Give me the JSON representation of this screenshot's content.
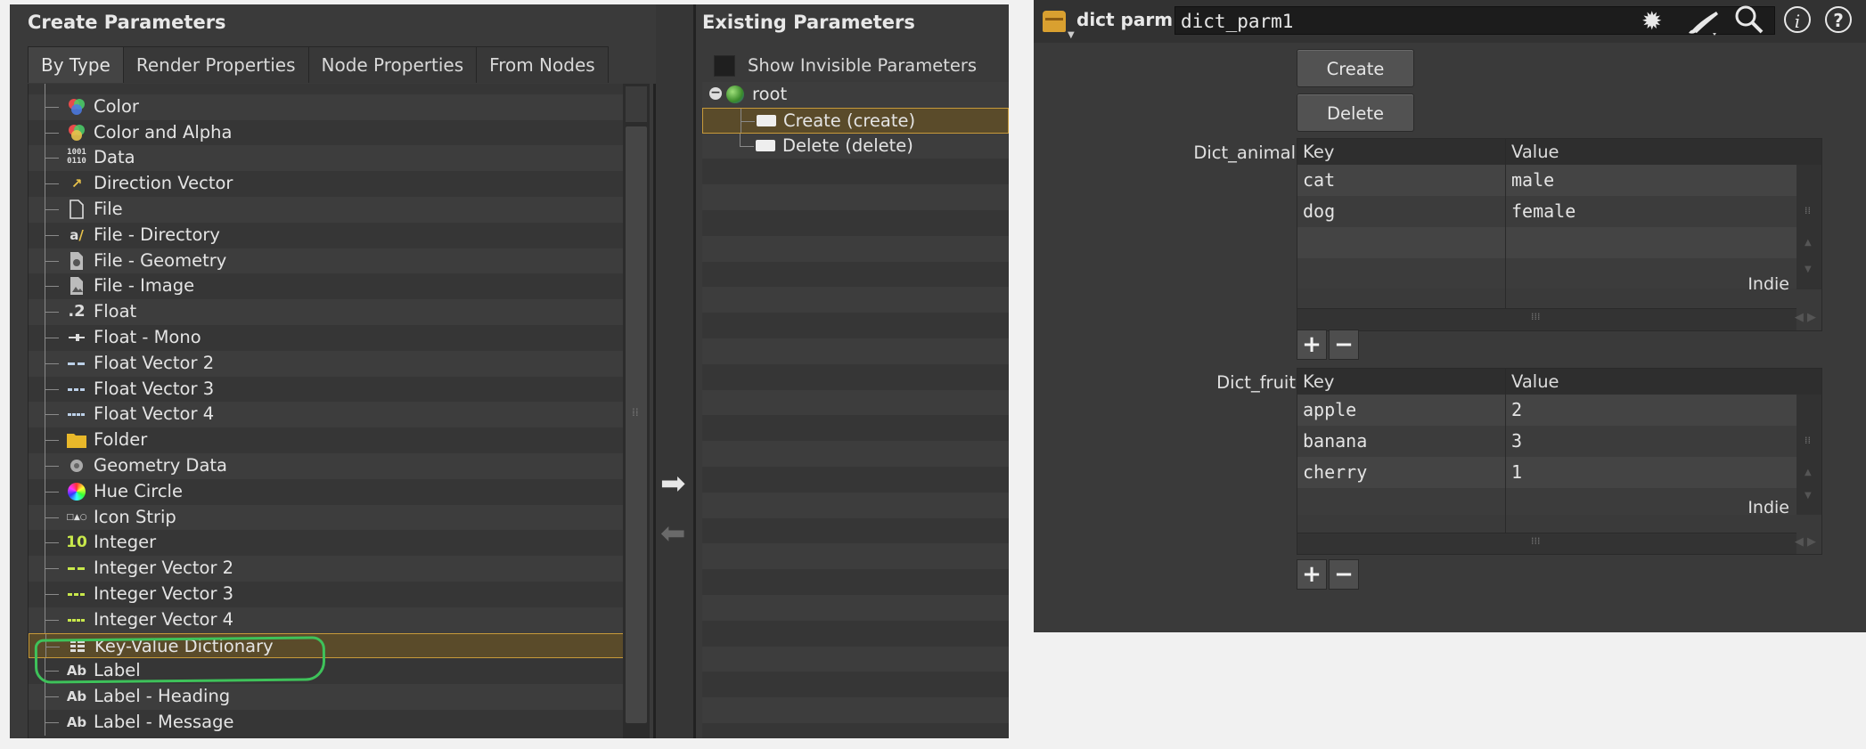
{
  "left_panel": {
    "create_title": "Create Parameters",
    "existing_title": "Existing Parameters",
    "tabs": [
      {
        "label": "By Type",
        "active": true
      },
      {
        "label": "Render Properties",
        "active": false
      },
      {
        "label": "Node Properties",
        "active": false
      },
      {
        "label": "From Nodes",
        "active": false
      }
    ],
    "types": [
      {
        "label": "Color",
        "icon": "color-icon"
      },
      {
        "label": "Color and Alpha",
        "icon": "color-alpha-icon"
      },
      {
        "label": "Data",
        "icon": "data-icon"
      },
      {
        "label": "Direction Vector",
        "icon": "direction-vector-icon"
      },
      {
        "label": "File",
        "icon": "file-icon"
      },
      {
        "label": "File - Directory",
        "icon": "directory-icon"
      },
      {
        "label": "File - Geometry",
        "icon": "geometry-file-icon"
      },
      {
        "label": "File - Image",
        "icon": "image-file-icon"
      },
      {
        "label": "Float",
        "icon": "float-icon"
      },
      {
        "label": "Float - Mono",
        "icon": "float-mono-icon"
      },
      {
        "label": "Float Vector 2",
        "icon": "float-vector2-icon"
      },
      {
        "label": "Float Vector 3",
        "icon": "float-vector3-icon"
      },
      {
        "label": "Float Vector 4",
        "icon": "float-vector4-icon"
      },
      {
        "label": "Folder",
        "icon": "folder-icon"
      },
      {
        "label": "Geometry Data",
        "icon": "geometry-data-icon"
      },
      {
        "label": "Hue Circle",
        "icon": "hue-circle-icon"
      },
      {
        "label": "Icon Strip",
        "icon": "icon-strip-icon"
      },
      {
        "label": "Integer",
        "icon": "integer-icon"
      },
      {
        "label": "Integer Vector 2",
        "icon": "integer-vector2-icon"
      },
      {
        "label": "Integer Vector 3",
        "icon": "integer-vector3-icon"
      },
      {
        "label": "Integer Vector 4",
        "icon": "integer-vector4-icon"
      },
      {
        "label": "Key-Value Dictionary",
        "icon": "key-value-icon",
        "selected": true
      },
      {
        "label": "Label",
        "icon": "label-icon"
      },
      {
        "label": "Label - Heading",
        "icon": "label-heading-icon"
      },
      {
        "label": "Label - Message",
        "icon": "label-message-icon"
      }
    ],
    "show_invisible_label": "Show Invisible Parameters",
    "existing_tree": [
      {
        "label": "root",
        "kind": "root"
      },
      {
        "label": "Create (create)",
        "kind": "parm",
        "selected": true
      },
      {
        "label": "Delete (delete)",
        "kind": "parm"
      }
    ]
  },
  "right_panel": {
    "node_type": "dict parm",
    "node_name": "dict_parm1",
    "create_button": "Create",
    "delete_button": "Delete",
    "dict_animal": {
      "label": "Dict_animal",
      "key_header": "Key",
      "value_header": "Value",
      "rows": [
        {
          "key": "cat",
          "value": "male"
        },
        {
          "key": "dog",
          "value": "female"
        }
      ],
      "watermark": "Indie"
    },
    "dict_fruit": {
      "label": "Dict_fruit",
      "key_header": "Key",
      "value_header": "Value",
      "rows": [
        {
          "key": "apple",
          "value": "2"
        },
        {
          "key": "banana",
          "value": "3"
        },
        {
          "key": "cherry",
          "value": "1"
        }
      ],
      "watermark": "Indie"
    },
    "add_glyph": "+",
    "remove_glyph": "−"
  },
  "colors": {
    "panel_bg": "#3a3a3a",
    "selection_border": "#c79a3a",
    "annotation_green": "#3ec25a"
  }
}
